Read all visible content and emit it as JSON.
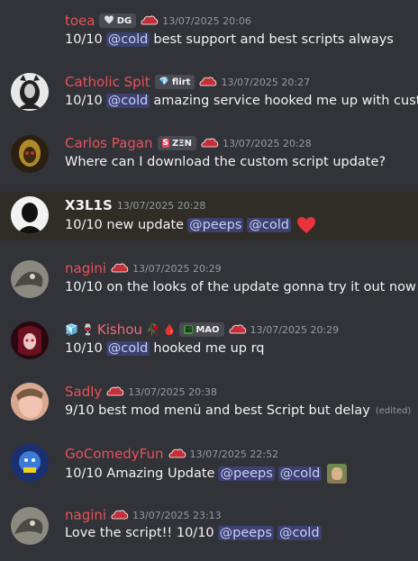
{
  "messages": [
    {
      "user": "toea",
      "tag": "DG",
      "tag_icon": "heart-icon",
      "timestamp": "13/07/2025 20:06",
      "parts": [
        {
          "text": "10/10"
        },
        {
          "mention": "@cold"
        },
        {
          "text": "best support and best scripts always"
        }
      ]
    },
    {
      "user": "Catholic Spit",
      "tag": "flirt",
      "tag_icon": "gem-icon",
      "timestamp": "13/07/2025 20:27",
      "parts": [
        {
          "text": "10/10"
        },
        {
          "mention": "@cold"
        },
        {
          "text": "amazing service hooked me up with custo"
        }
      ]
    },
    {
      "user": "Carlos Pagan",
      "tag": "ZΞN",
      "tag_icon": "zen-logo-icon",
      "timestamp": "13/07/2025 20:28",
      "parts": [
        {
          "text": "Where can I download the custom script update?"
        }
      ]
    },
    {
      "user": "X3L1S",
      "timestamp": "13/07/2025 20:28",
      "parts": [
        {
          "text": "10/10 new update"
        },
        {
          "mention": "@peeps"
        },
        {
          "mention": "@cold"
        }
      ]
    },
    {
      "user": "nagini",
      "timestamp": "13/07/2025 20:29",
      "parts": [
        {
          "text": "10/10 on the looks of the update gonna try it out now"
        }
      ]
    },
    {
      "user": "Kishou",
      "tag": "MAO",
      "tag_icon": "creeper-icon",
      "timestamp": "13/07/2025 20:29",
      "parts": [
        {
          "text": "10/10"
        },
        {
          "mention": "@cold"
        },
        {
          "text": "hooked me up rq"
        }
      ]
    },
    {
      "user": "Sadly",
      "timestamp": "13/07/2025 20:38",
      "parts": [
        {
          "text": "9/10 best mod menü and best Script but delay"
        }
      ],
      "edited": "(edited)"
    },
    {
      "user": "GoComedyFun",
      "timestamp": "13/07/2025 22:52",
      "parts": [
        {
          "text": "10/10 Amazing Update"
        },
        {
          "mention": "@peeps"
        },
        {
          "mention": "@cold"
        }
      ]
    },
    {
      "user": "nagini",
      "timestamp": "13/07/2025 23:13",
      "parts": [
        {
          "text": "Love the script!! 10/10"
        },
        {
          "mention": "@peeps"
        },
        {
          "mention": "@cold"
        }
      ]
    }
  ],
  "colors": {
    "background": "#313338",
    "highlight": "#2f2d26",
    "username_red": "#e8525a",
    "mention_bg": "#3c4270"
  }
}
